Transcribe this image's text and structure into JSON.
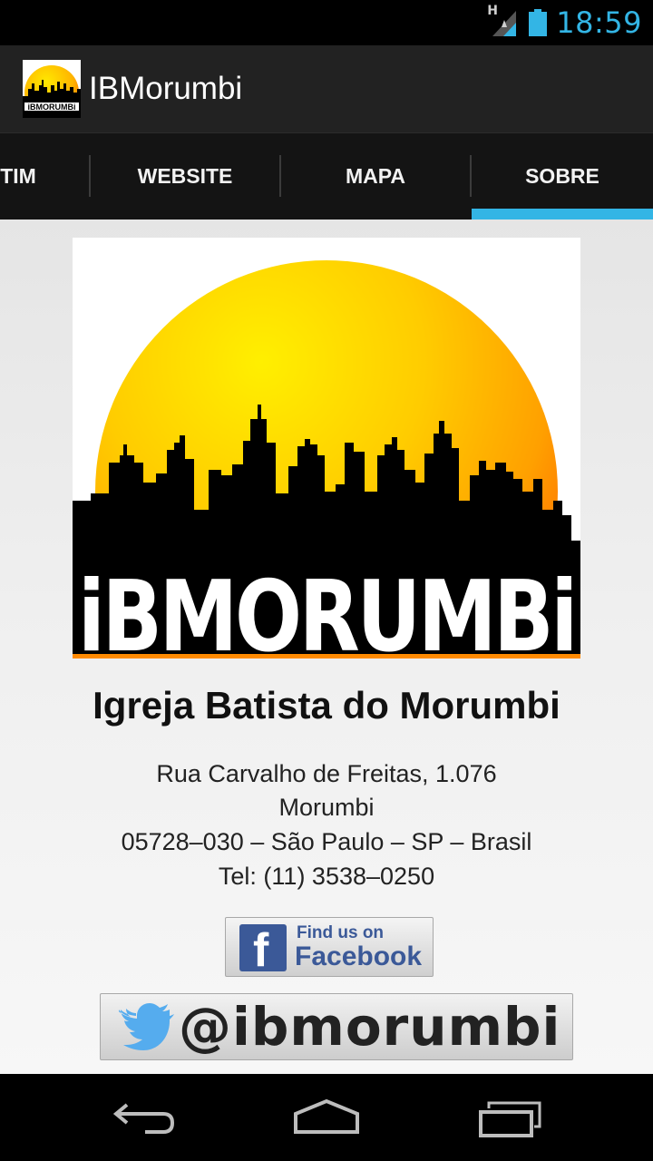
{
  "status_bar": {
    "time": "18:59",
    "network_type": "H",
    "icons": [
      "signal-icon",
      "battery-icon"
    ]
  },
  "action_bar": {
    "app_title": "IBMorumbi",
    "app_icon": "ibmorumbi-logo-icon"
  },
  "tabs": [
    {
      "label": "TIM",
      "selected": false
    },
    {
      "label": "WEBSITE",
      "selected": false
    },
    {
      "label": "MAPA",
      "selected": false
    },
    {
      "label": "SOBRE",
      "selected": true
    }
  ],
  "about": {
    "logo_text": "iBMORUMBi",
    "church_name": "Igreja Batista do Morumbi",
    "address_lines": [
      "Rua Carvalho de Freitas, 1.076",
      "Morumbi",
      "05728–030 – São Paulo – SP – Brasil",
      "Tel: (11) 3538–0250"
    ],
    "facebook": {
      "line1": "Find us on",
      "line2": "Facebook"
    },
    "twitter": {
      "handle": "@ibmorumbi"
    }
  },
  "colors": {
    "accent": "#33b5e5",
    "action_bar": "#222222",
    "tab_bar": "#141414",
    "facebook_blue": "#3b5998",
    "twitter_blue": "#55acee"
  },
  "nav_bar": [
    "back-icon",
    "home-icon",
    "recent-apps-icon"
  ]
}
